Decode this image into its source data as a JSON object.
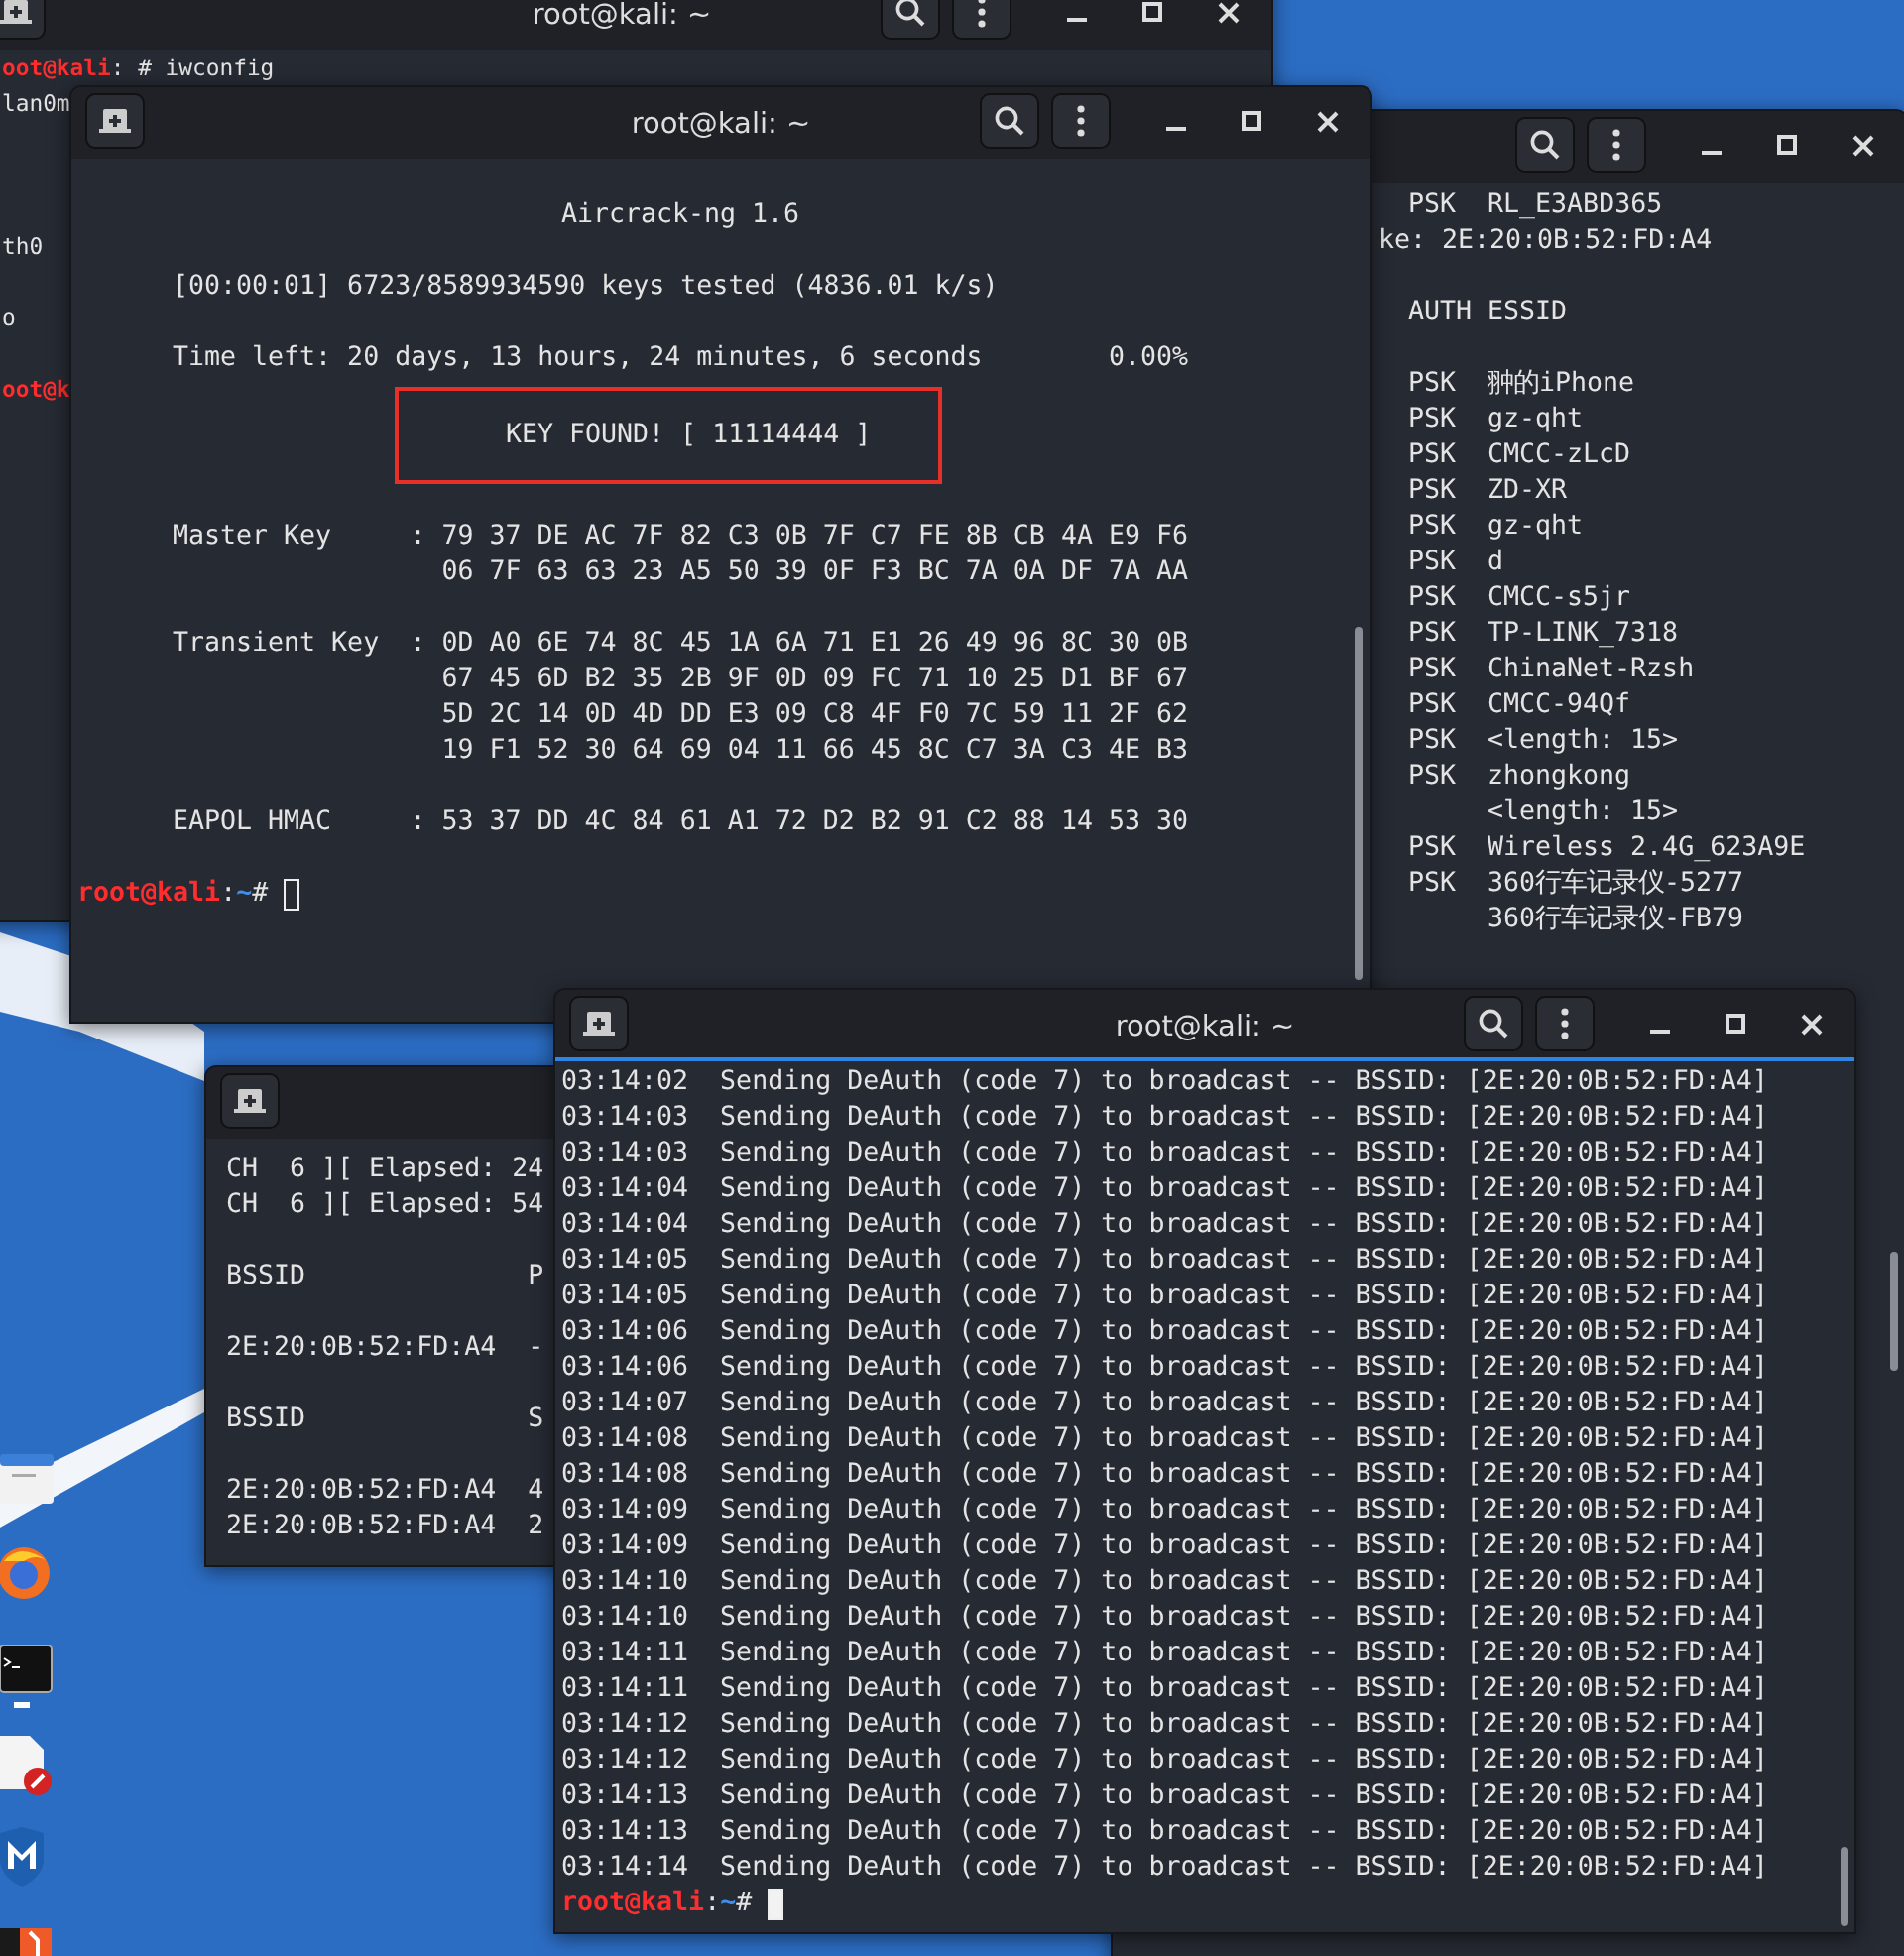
{
  "back_terminal": {
    "title": "root@kali: ~",
    "active": false,
    "lines": [
      {
        "kind": "prompt",
        "host": "oot@kali",
        "text": ": # iwconfig"
      },
      {
        "kind": "output",
        "text": "lan0m"
      },
      {
        "kind": "output",
        "text": "th0"
      },
      {
        "kind": "output",
        "text": "o"
      },
      {
        "kind": "prompt",
        "host": "oot@k"
      }
    ]
  },
  "scan_terminal": {
    "active": false,
    "top_rows": [
      {
        "auth": "PSK",
        "essid": "RL_E3ABD365"
      }
    ],
    "handshake_fragment": "ke: 2E:20:0B:52:FD:A4",
    "header": "AUTH ESSID",
    "rows": [
      {
        "auth": "PSK",
        "essid": "翀的iPhone"
      },
      {
        "auth": "PSK",
        "essid": "gz-qht"
      },
      {
        "auth": "PSK",
        "essid": "CMCC-zLcD"
      },
      {
        "auth": "PSK",
        "essid": "ZD-XR"
      },
      {
        "auth": "PSK",
        "essid": "gz-qht"
      },
      {
        "auth": "PSK",
        "essid": "d"
      },
      {
        "auth": "PSK",
        "essid": "CMCC-s5jr"
      },
      {
        "auth": "PSK",
        "essid": "TP-LINK_7318"
      },
      {
        "auth": "PSK",
        "essid": "ChinaNet-Rzsh"
      },
      {
        "auth": "PSK",
        "essid": "CMCC-94Qf"
      },
      {
        "auth": "PSK",
        "essid": "<length: 15>"
      },
      {
        "auth": "PSK",
        "essid": "zhongkong"
      },
      {
        "essid": "<length: 15>"
      },
      {
        "auth": "PSK",
        "essid": "Wireless 2.4G_623A9E"
      },
      {
        "auth": "PSK",
        "essid": "360行车记录仪-5277"
      },
      {
        "essid": "360行车记录仪-FB79"
      }
    ]
  },
  "aircrack_terminal": {
    "title": "root@kali: ~",
    "active": false,
    "header": "Aircrack-ng 1.6",
    "progress": "[00:00:01] 6723/8589934590 keys tested (4836.01 k/s)",
    "time_left": "Time left: 20 days, 13 hours, 24 minutes, 6 seconds",
    "percent": "0.00%",
    "key_found": "KEY FOUND! [ 11114444 ]",
    "keys": [
      {
        "label": "Master Key",
        "separator": ":",
        "lines": [
          "79 37 DE AC 7F 82 C3 0B 7F C7 FE 8B CB 4A E9 F6",
          "06 7F 63 63 23 A5 50 39 0F F3 BC 7A 0A DF 7A AA"
        ]
      },
      {
        "label": "Transient Key",
        "separator": ":",
        "lines": [
          "0D A0 6E 74 8C 45 1A 6A 71 E1 26 49 96 8C 30 0B",
          "67 45 6D B2 35 2B 9F 0D 09 FC 71 10 25 D1 BF 67",
          "5D 2C 14 0D 4D DD E3 09 C8 4F F0 7C 59 11 2F 62",
          "19 F1 52 30 64 69 04 11 66 45 8C C7 3A C3 4E B3"
        ]
      },
      {
        "label": "EAPOL HMAC",
        "separator": ":",
        "lines": [
          "53 37 DD 4C 84 61 A1 72 D2 B2 91 C2 88 14 53 30"
        ]
      }
    ],
    "prompt": {
      "user_host": "root@kali",
      "separator": ":",
      "path": "~",
      "symbol": "#",
      "cursor": true
    }
  },
  "station_terminal": {
    "active": false,
    "sections": [
      [
        "CH  6 ][ Elapsed: 24",
        "CH  6 ][ Elapsed: 54"
      ],
      [
        "BSSID              P"
      ],
      [
        "2E:20:0B:52:FD:A4  -"
      ],
      [
        "BSSID              S"
      ],
      [
        "2E:20:0B:52:FD:A4  4",
        "2E:20:0B:52:FD:A4  2"
      ]
    ]
  },
  "deauth_terminal": {
    "title": "root@kali: ~",
    "active": true,
    "lines": [
      "03:14:02  Sending DeAuth (code 7) to broadcast -- BSSID: [2E:20:0B:52:FD:A4]",
      "03:14:03  Sending DeAuth (code 7) to broadcast -- BSSID: [2E:20:0B:52:FD:A4]",
      "03:14:03  Sending DeAuth (code 7) to broadcast -- BSSID: [2E:20:0B:52:FD:A4]",
      "03:14:04  Sending DeAuth (code 7) to broadcast -- BSSID: [2E:20:0B:52:FD:A4]",
      "03:14:04  Sending DeAuth (code 7) to broadcast -- BSSID: [2E:20:0B:52:FD:A4]",
      "03:14:05  Sending DeAuth (code 7) to broadcast -- BSSID: [2E:20:0B:52:FD:A4]",
      "03:14:05  Sending DeAuth (code 7) to broadcast -- BSSID: [2E:20:0B:52:FD:A4]",
      "03:14:06  Sending DeAuth (code 7) to broadcast -- BSSID: [2E:20:0B:52:FD:A4]",
      "03:14:06  Sending DeAuth (code 7) to broadcast -- BSSID: [2E:20:0B:52:FD:A4]",
      "03:14:07  Sending DeAuth (code 7) to broadcast -- BSSID: [2E:20:0B:52:FD:A4]",
      "03:14:08  Sending DeAuth (code 7) to broadcast -- BSSID: [2E:20:0B:52:FD:A4]",
      "03:14:08  Sending DeAuth (code 7) to broadcast -- BSSID: [2E:20:0B:52:FD:A4]",
      "03:14:09  Sending DeAuth (code 7) to broadcast -- BSSID: [2E:20:0B:52:FD:A4]",
      "03:14:09  Sending DeAuth (code 7) to broadcast -- BSSID: [2E:20:0B:52:FD:A4]",
      "03:14:10  Sending DeAuth (code 7) to broadcast -- BSSID: [2E:20:0B:52:FD:A4]",
      "03:14:10  Sending DeAuth (code 7) to broadcast -- BSSID: [2E:20:0B:52:FD:A4]",
      "03:14:11  Sending DeAuth (code 7) to broadcast -- BSSID: [2E:20:0B:52:FD:A4]",
      "03:14:11  Sending DeAuth (code 7) to broadcast -- BSSID: [2E:20:0B:52:FD:A4]",
      "03:14:12  Sending DeAuth (code 7) to broadcast -- BSSID: [2E:20:0B:52:FD:A4]",
      "03:14:12  Sending DeAuth (code 7) to broadcast -- BSSID: [2E:20:0B:52:FD:A4]",
      "03:14:13  Sending DeAuth (code 7) to broadcast -- BSSID: [2E:20:0B:52:FD:A4]",
      "03:14:13  Sending DeAuth (code 7) to broadcast -- BSSID: [2E:20:0B:52:FD:A4]",
      "03:14:14  Sending DeAuth (code 7) to broadcast -- BSSID: [2E:20:0B:52:FD:A4]"
    ],
    "prompt": {
      "user_host": "root@kali",
      "separator": ":",
      "path": "~",
      "symbol": "#",
      "cursor": true
    }
  }
}
